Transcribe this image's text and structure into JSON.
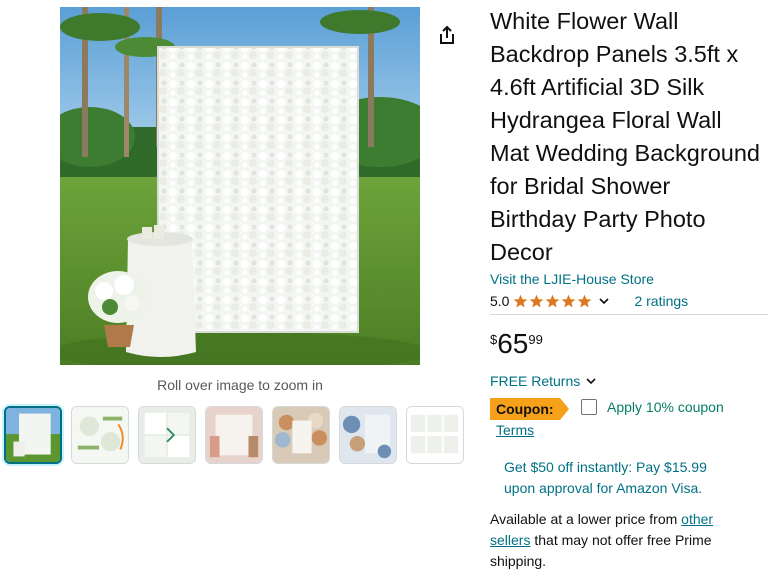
{
  "product": {
    "title": "White Flower Wall Backdrop Panels 3.5ft x 4.6ft Artificial 3D Silk Hydrangea Floral Wall Mat Wedding Background for Bridal Shower Birthday Party Photo Decor",
    "store_link": "Visit the LJIE-House Store",
    "rating_value": "5.0",
    "rating_stars": 5,
    "ratings_count": "2 ratings"
  },
  "gallery": {
    "zoom_hint": "Roll over image to zoom in",
    "thumbnails": [
      {
        "icon": "flower-wall-garden-thumbnail",
        "active": true
      },
      {
        "icon": "infographic-thumbnail"
      },
      {
        "icon": "panel-detail-thumbnail"
      },
      {
        "icon": "pink-wall-thumbnail"
      },
      {
        "icon": "balloon-arch-thumbnail"
      },
      {
        "icon": "blue-balloon-thumbnail"
      },
      {
        "icon": "panel-grid-thumbnail"
      }
    ]
  },
  "price": {
    "symbol": "$",
    "whole": "65",
    "fraction": "99"
  },
  "returns": {
    "label": "FREE Returns"
  },
  "coupon": {
    "badge": "Coupon:",
    "text": "Apply 10% coupon",
    "terms": "Terms"
  },
  "promo": {
    "line1": "Get $50 off instantly: Pay $15.99",
    "line2": "upon approval for Amazon Visa."
  },
  "lower_price": {
    "prefix": "Available at a lower price from ",
    "link1": "other",
    "link2": "sellers",
    "suffix": " that may not offer free Prime shipping."
  },
  "colors": {
    "link": "#007185",
    "star": "#de7921",
    "coupon_badge": "#f7a01a",
    "coupon_text": "#067d62"
  }
}
